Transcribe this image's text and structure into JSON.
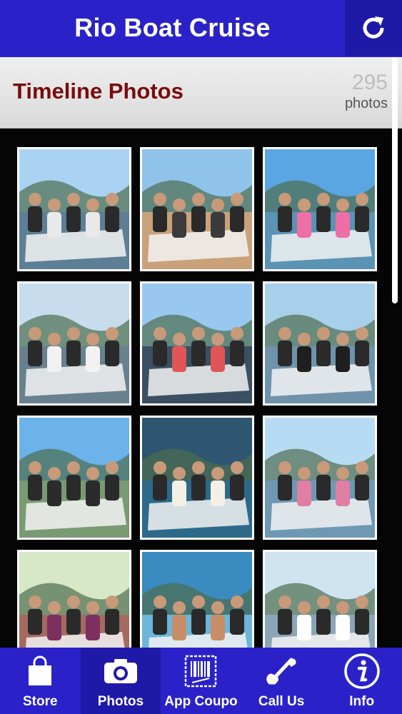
{
  "header": {
    "title": "Rio Boat Cruise",
    "refresh_icon": "refresh-icon"
  },
  "subheader": {
    "heading": "Timeline Photos",
    "count": "295",
    "count_unit": "photos"
  },
  "photos": [
    {
      "icon": "photo-thumbnail",
      "sky": "#a9d3f0",
      "water": "#5d7f95",
      "accent": "#e9e9e9"
    },
    {
      "icon": "photo-thumbnail",
      "sky": "#8fc3ea",
      "water": "#c9a27b",
      "accent": "#3b3b3b"
    },
    {
      "icon": "photo-thumbnail",
      "sky": "#5aa6e2",
      "water": "#5b93b4",
      "accent": "#ee6fa6"
    },
    {
      "icon": "photo-thumbnail",
      "sky": "#c7dced",
      "water": "#69808e",
      "accent": "#f2f2f2"
    },
    {
      "icon": "photo-thumbnail",
      "sky": "#98c8ef",
      "water": "#3a4f62",
      "accent": "#e05555"
    },
    {
      "icon": "photo-thumbnail",
      "sky": "#a8d0ea",
      "water": "#6e93aa",
      "accent": "#1f1f1f"
    },
    {
      "icon": "photo-thumbnail",
      "sky": "#6bb3ea",
      "water": "#7a9a73",
      "accent": "#2b2b2b"
    },
    {
      "icon": "photo-thumbnail",
      "sky": "#2e5670",
      "water": "#2d6a8a",
      "accent": "#f4f0e6"
    },
    {
      "icon": "photo-thumbnail",
      "sky": "#b7dbf2",
      "water": "#6f99b3",
      "accent": "#e07ea3"
    },
    {
      "icon": "photo-thumbnail",
      "sky": "#d6e8c5",
      "water": "#a36b60",
      "accent": "#7d3060"
    },
    {
      "icon": "photo-thumbnail",
      "sky": "#3a8bc0",
      "water": "#6cb6d9",
      "accent": "#c88e6a"
    },
    {
      "icon": "photo-thumbnail",
      "sky": "#cfe3f0",
      "water": "#8aa5b7",
      "accent": "#ffffff"
    }
  ],
  "nav": [
    {
      "label": "Store",
      "icon": "shopping-bag-icon",
      "active": false
    },
    {
      "label": "Photos",
      "icon": "camera-icon",
      "active": true
    },
    {
      "label": "App Coupo",
      "icon": "coupon-barcode-icon",
      "active": false
    },
    {
      "label": "Call Us",
      "icon": "phone-icon",
      "active": false
    },
    {
      "label": "Info",
      "icon": "info-icon",
      "active": false
    }
  ],
  "colors": {
    "topbar": "#2a22c8",
    "heading": "#7a0b0b",
    "background": "#000000"
  }
}
